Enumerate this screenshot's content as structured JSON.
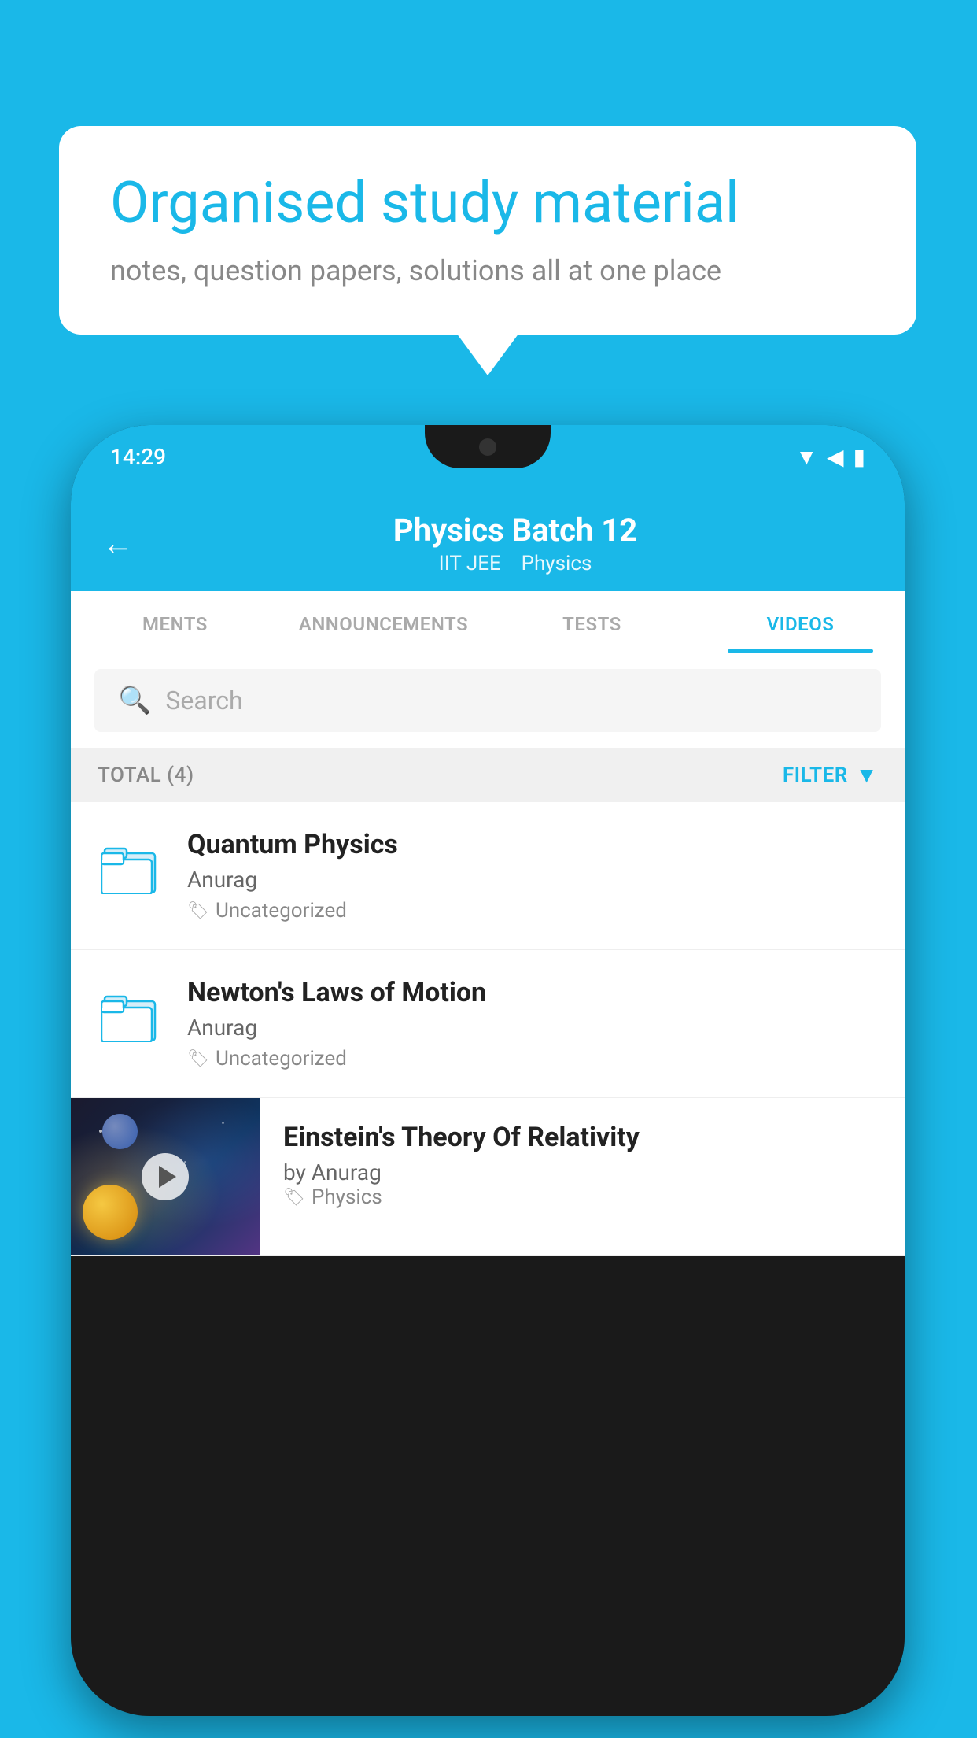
{
  "background_color": "#1ab8e8",
  "speech_bubble": {
    "title": "Organised study material",
    "subtitle": "notes, question papers, solutions all at one place"
  },
  "phone": {
    "status_bar": {
      "time": "14:29",
      "wifi_icon": "wifi",
      "signal_icon": "signal",
      "battery_icon": "battery"
    },
    "header": {
      "back_label": "←",
      "title": "Physics Batch 12",
      "subtitle_tag1": "IIT JEE",
      "subtitle_tag2": "Physics"
    },
    "tabs": [
      {
        "label": "MENTS",
        "active": false
      },
      {
        "label": "ANNOUNCEMENTS",
        "active": false
      },
      {
        "label": "TESTS",
        "active": false
      },
      {
        "label": "VIDEOS",
        "active": true
      }
    ],
    "search": {
      "placeholder": "Search"
    },
    "filter_bar": {
      "total_label": "TOTAL (4)",
      "filter_btn": "FILTER"
    },
    "videos": [
      {
        "title": "Quantum Physics",
        "author": "Anurag",
        "tag": "Uncategorized",
        "has_thumb": false
      },
      {
        "title": "Newton's Laws of Motion",
        "author": "Anurag",
        "tag": "Uncategorized",
        "has_thumb": false
      },
      {
        "title": "Einstein's Theory Of Relativity",
        "author": "by Anurag",
        "tag": "Physics",
        "has_thumb": true
      }
    ]
  },
  "colors": {
    "brand": "#1ab8e8",
    "text_dark": "#222222",
    "text_mid": "#666666",
    "text_light": "#888888",
    "active_tab": "#1ab8e8"
  }
}
